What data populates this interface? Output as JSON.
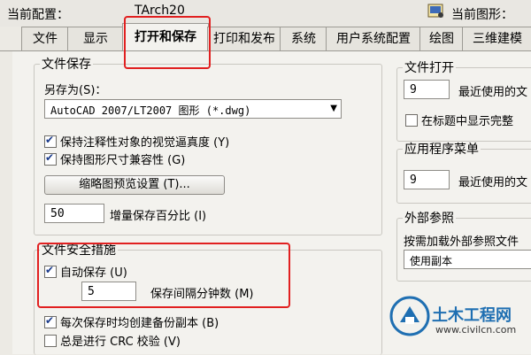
{
  "top": {
    "current_config_label": "当前配置：",
    "current_config_value": "TArch20",
    "current_drawing_label": "当前图形："
  },
  "tabs": [
    {
      "label": "文件"
    },
    {
      "label": "显示"
    },
    {
      "label": "打开和保存"
    },
    {
      "label": "打印和发布"
    },
    {
      "label": "系统"
    },
    {
      "label": "用户系统配置"
    },
    {
      "label": "绘图"
    },
    {
      "label": "三维建模"
    }
  ],
  "file_save": {
    "title": "文件保存",
    "save_as_label": "另存为(S)：",
    "save_as_value": "AutoCAD 2007/LT2007 图形 (*.dwg)",
    "maintain_annotative_label": "保持注释性对象的视觉逼真度 (Y)",
    "maintain_drawing_size_label": "保持图形尺寸兼容性 (G)",
    "thumbnail_button": "缩略图预览设置 (T)...",
    "incremental_save_value": "50",
    "incremental_save_label": "增量保存百分比 (I)"
  },
  "file_safety": {
    "title": "文件安全措施",
    "autosave_label": "自动保存 (U)",
    "minutes_value": "5",
    "minutes_label": "保存间隔分钟数 (M)",
    "backup_label": "每次保存时均创建备份副本 (B)",
    "crc_label": "总是进行 CRC 校验 (V)"
  },
  "file_open": {
    "title": "文件打开",
    "recent_files_value": "9",
    "recent_files_label": "最近使用的文",
    "full_path_label": "在标题中显示完整"
  },
  "app_menu": {
    "title": "应用程序菜单",
    "recent_value": "9",
    "recent_label": "最近使用的文"
  },
  "xref": {
    "title": "外部参照",
    "demand_load_label": "按需加载外部参照文件",
    "demand_load_value": "使用副本"
  },
  "watermark": {
    "name": "土木工程网",
    "url": "www.civilcn.com"
  },
  "colors": {
    "highlight": "#e12020",
    "check": "#1a3a8a",
    "watermark_blue": "#1f6fb2"
  }
}
